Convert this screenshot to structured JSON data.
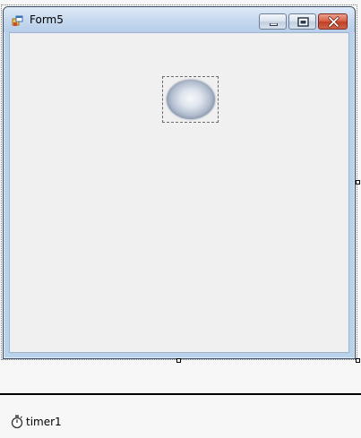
{
  "form": {
    "title": "Form5"
  },
  "tray": {
    "components": [
      {
        "label": "timer1",
        "icon": "stopwatch-icon"
      }
    ]
  },
  "icons": {
    "app": "windows-form-icon",
    "minimize": "minimize-icon",
    "maximize": "maximize-icon",
    "close": "close-icon",
    "timer": "stopwatch-icon"
  },
  "colors": {
    "title_bar": "#c7d9ef",
    "client_area": "#f0f0f0",
    "close_button": "#c94a33",
    "frame_border": "#b9d1ea"
  }
}
